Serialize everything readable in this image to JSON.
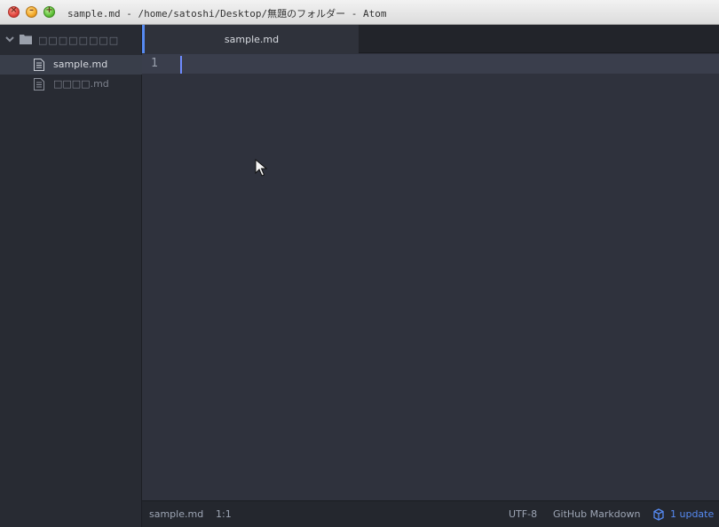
{
  "window": {
    "title": "sample.md - /home/satoshi/Desktop/無題のフォルダー - Atom",
    "buttons": {
      "close": "×",
      "minimize": "–",
      "maximize": "+"
    }
  },
  "tree": {
    "root_folder": "□□□□□□□□",
    "files": [
      {
        "name": "sample.md",
        "selected": true
      },
      {
        "name": "□□□□.md",
        "selected": false
      }
    ]
  },
  "tabs": [
    {
      "label": "sample.md",
      "active": true
    }
  ],
  "editor": {
    "line_numbers": [
      "1"
    ]
  },
  "status_bar": {
    "file": "sample.md",
    "cursor_position": "1:1",
    "encoding": "UTF-8",
    "grammar": "GitHub Markdown",
    "update": "1 update"
  },
  "colors": {
    "accent": "#568af2",
    "editor_bg": "#2f323d",
    "sidebar_bg": "#282b33"
  }
}
